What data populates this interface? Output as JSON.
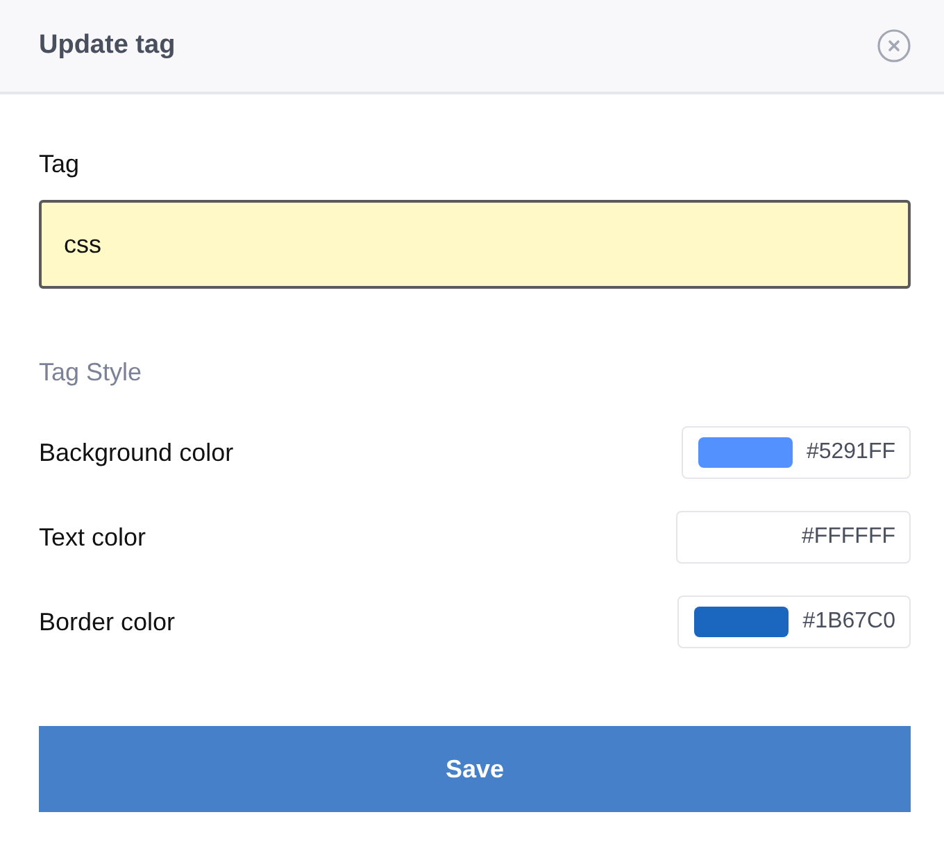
{
  "dialog": {
    "title": "Update tag"
  },
  "tag_field": {
    "label": "Tag",
    "value": "css"
  },
  "section_title": "Tag Style",
  "color_rows": [
    {
      "label": "Background color",
      "value": "#5291FF",
      "color": "#5291ff"
    },
    {
      "label": "Text color",
      "value": "#FFFFFF"
    },
    {
      "label": "Border color",
      "value": "#1B67C0",
      "color": "#1b67c0"
    }
  ],
  "buttons": [
    "Save"
  ]
}
